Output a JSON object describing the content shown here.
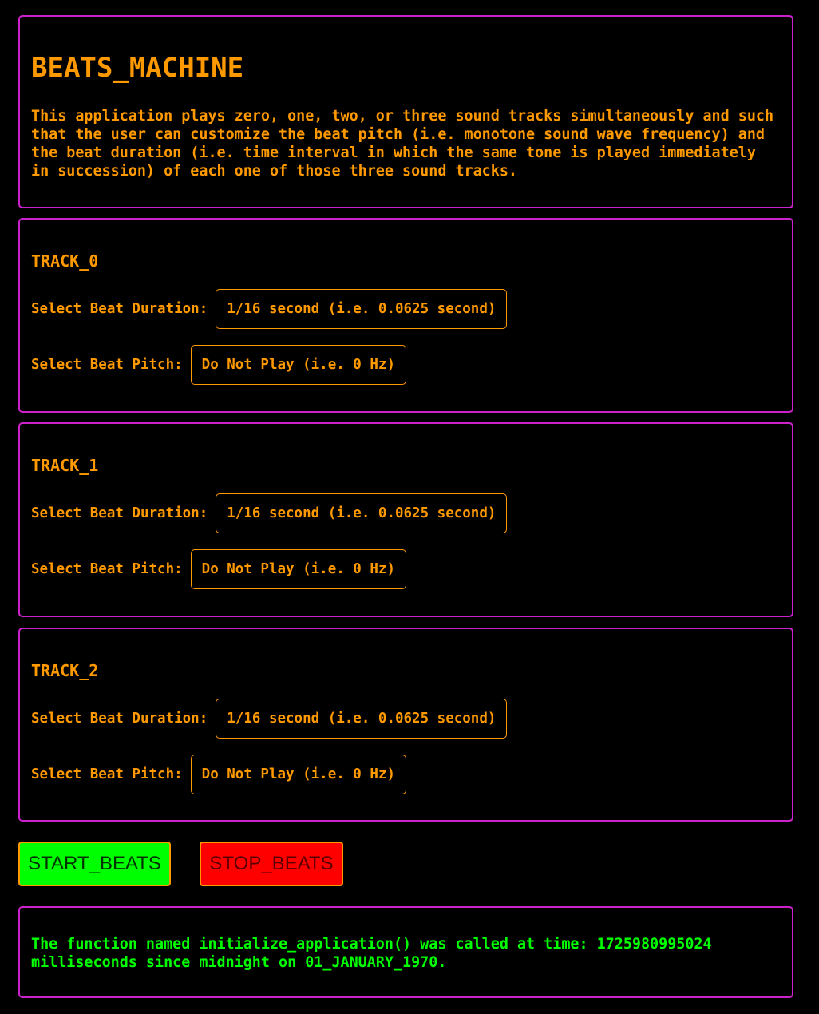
{
  "app": {
    "title": "BEATS_MACHINE",
    "description": "This application plays zero, one, two, or three sound tracks simultaneously and such that the user can customize the beat pitch (i.e. monotone sound wave frequency) and the beat duration (i.e. time interval in which the same tone is played immediately in succession) of each one of those three sound tracks."
  },
  "tracks": [
    {
      "title": "TRACK_0",
      "duration_label": "Select Beat Duration:",
      "duration_value": "1/16 second (i.e. 0.0625 second)",
      "pitch_label": "Select Beat Pitch:",
      "pitch_value": "Do Not Play (i.e. 0 Hz)"
    },
    {
      "title": "TRACK_1",
      "duration_label": "Select Beat Duration:",
      "duration_value": "1/16 second (i.e. 0.0625 second)",
      "pitch_label": "Select Beat Pitch:",
      "pitch_value": "Do Not Play (i.e. 0 Hz)"
    },
    {
      "title": "TRACK_2",
      "duration_label": "Select Beat Duration:",
      "duration_value": "1/16 second (i.e. 0.0625 second)",
      "pitch_label": "Select Beat Pitch:",
      "pitch_value": "Do Not Play (i.e. 0 Hz)"
    }
  ],
  "controls": {
    "start_label": "START_BEATS",
    "stop_label": "STOP_BEATS"
  },
  "log": {
    "message": "The function named initialize_application() was called at time: 1725980995024 milliseconds since midnight on 01_JANUARY_1970."
  },
  "colors": {
    "background": "#000000",
    "panel_border": "#cc22cc",
    "text_primary": "#ff9900",
    "log_text": "#00ff00",
    "start_button": "#00ff00",
    "stop_button": "#ff0000"
  }
}
